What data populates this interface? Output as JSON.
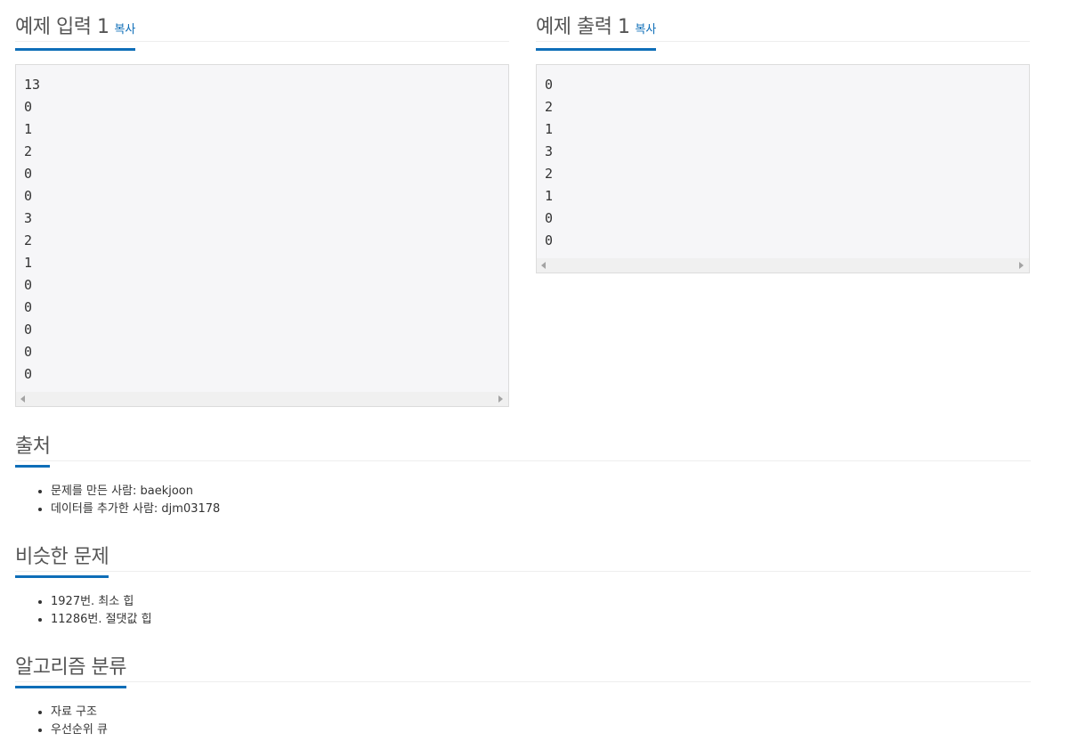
{
  "sample_input": {
    "title": "예제 입력 1",
    "copy_label": "복사",
    "content": "13\n0\n1\n2\n0\n0\n3\n2\n1\n0\n0\n0\n0\n0"
  },
  "sample_output": {
    "title": "예제 출력 1",
    "copy_label": "복사",
    "content": "0\n2\n1\n3\n2\n1\n0\n0"
  },
  "source": {
    "title": "출처",
    "items": [
      "문제를 만든 사람: baekjoon",
      "데이터를 추가한 사람: djm03178"
    ]
  },
  "similar": {
    "title": "비슷한 문제",
    "items": [
      "1927번. 최소 힙",
      "11286번. 절댓값 힙"
    ]
  },
  "algorithm": {
    "title": "알고리즘 분류",
    "items": [
      "자료 구조",
      "우선순위 큐"
    ]
  },
  "colors": {
    "accent": "#0e6eb8",
    "heading": "#555555",
    "pre_bg": "#f6f6f8"
  }
}
